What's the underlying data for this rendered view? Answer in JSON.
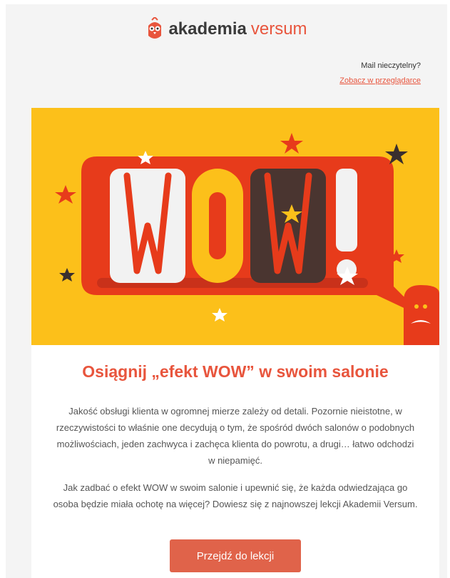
{
  "header": {
    "brand_part1": "akademia",
    "brand_part2": "versum",
    "unread_text": "Mail nieczytelny?",
    "browser_link": "Zobacz w przeglądarce"
  },
  "hero": {
    "wow_text": "WOW!"
  },
  "content": {
    "headline": "Osiągnij „efekt WOW” w swoim salonie",
    "paragraph1": "Jakość obsługi klienta w ogromnej mierze zależy od detali. Pozornie nieistotne, w rzeczywistości to właśnie one decydują o tym, że spośród dwóch salonów o podobnych możliwościach, jeden zachwyca i zachęca klienta do powrotu, a drugi… łatwo odchodzi w niepamięć.",
    "paragraph2": "Jak zadbać o efekt WOW w swoim salonie i upewnić się, że każda odwiedzająca go osoba będzie miała ochotę na więcej? Dowiesz się z najnowszej lekcji Akademii Versum.",
    "cta_label": "Przejdź do lekcji"
  },
  "colors": {
    "accent": "#e8553d",
    "hero_bg": "#fcc01a",
    "bubble": "#e73b1b",
    "letter_white": "#f2f2f2",
    "letter_yellow": "#fcc01a",
    "letter_dark": "#4a3530"
  }
}
